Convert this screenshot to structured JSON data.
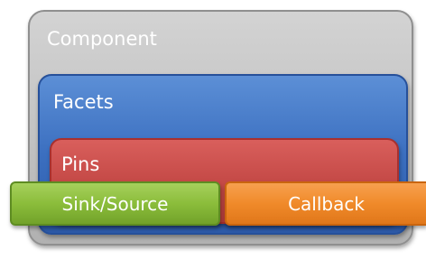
{
  "diagram": {
    "component": {
      "label": "Component"
    },
    "facets": {
      "label": "Facets"
    },
    "pins": {
      "label": "Pins"
    },
    "sink_source": {
      "label": "Sink/Source"
    },
    "callback": {
      "label": "Callback"
    }
  },
  "colors": {
    "component": "#c2c2c2",
    "facets": "#3b6fc0",
    "pins": "#c54a47",
    "sink_source": "#8bbd3b",
    "callback": "#f08a2a",
    "text": "#ffffff"
  }
}
